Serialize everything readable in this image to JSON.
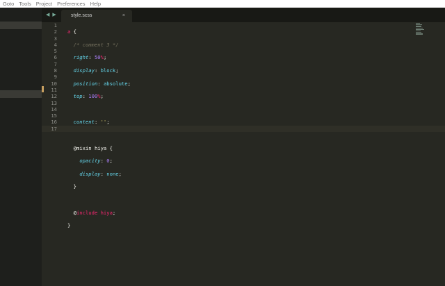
{
  "menu": [
    "Goto",
    "Tools",
    "Project",
    "Preferences",
    "Help"
  ],
  "tab": {
    "title": "style.scss",
    "close": "×",
    "nav": "◀ ▶"
  },
  "line_numbers": [
    "1",
    "2",
    "3",
    "4",
    "5",
    "6",
    "7",
    "8",
    "9",
    "10",
    "11",
    "12",
    "13",
    "14",
    "15",
    "16",
    "17"
  ],
  "code": {
    "l1": {
      "sel": "a",
      "rest": " {"
    },
    "l2": "/* comment 3 */",
    "l3": {
      "p": "right",
      "v": "50",
      "u": "%"
    },
    "l4": {
      "p": "display",
      "v": "block"
    },
    "l5": {
      "p": "position",
      "v": "absolute"
    },
    "l6": {
      "p": "top",
      "v": "100",
      "u": "%"
    },
    "l8": {
      "p": "content",
      "v": "''"
    },
    "l10": "@mixin hiya {",
    "l11": {
      "p": "opacity",
      "v": "0"
    },
    "l12": {
      "p": "display",
      "v": "none"
    },
    "l13": "}",
    "l15": {
      "at": "@",
      "kw": "include",
      "name": "hiya"
    },
    "l16": "}"
  }
}
